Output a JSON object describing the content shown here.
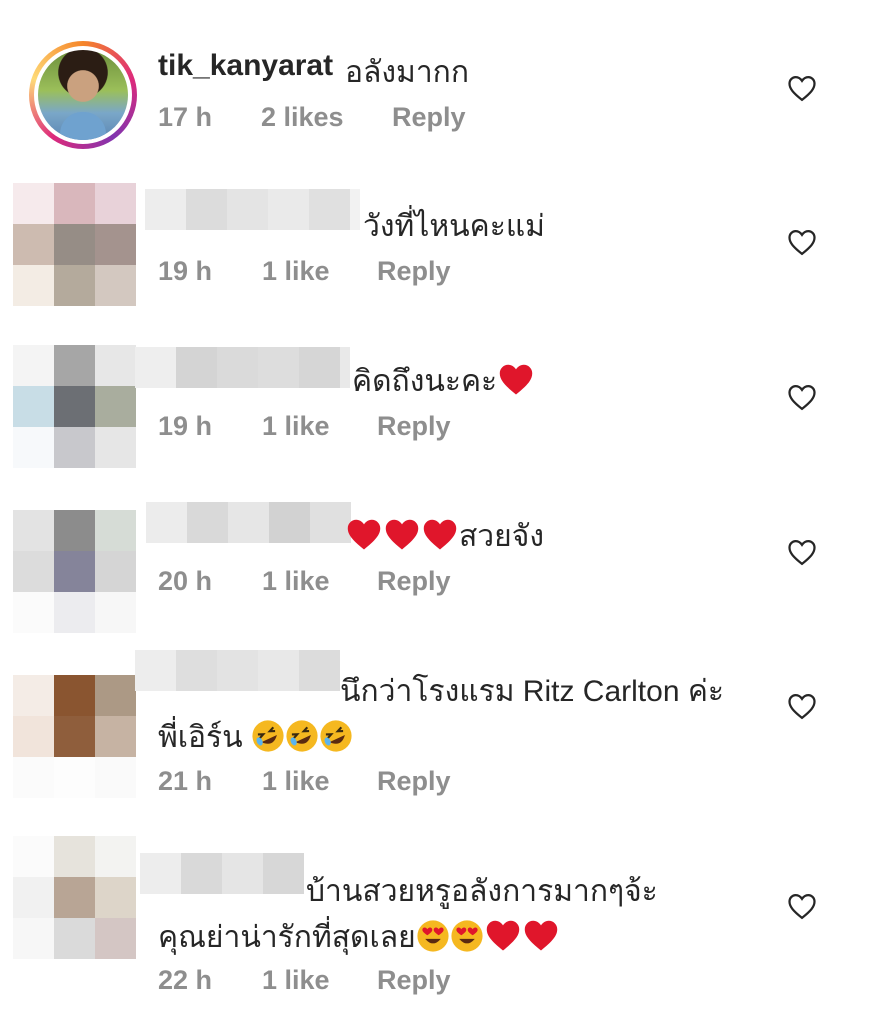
{
  "comments": [
    {
      "username": "tik_kanyarat",
      "text": "อลังมากก",
      "time": "17 h",
      "likes": "2 likes",
      "reply": "Reply"
    },
    {
      "text": "วังที่ไหนคะแม่",
      "time": "19 h",
      "likes": "1 like",
      "reply": "Reply"
    },
    {
      "text": "คิดถึงนะคะ",
      "time": "19 h",
      "likes": "1 like",
      "reply": "Reply"
    },
    {
      "text": "สวยจัง",
      "time": "20 h",
      "likes": "1 like",
      "reply": "Reply"
    },
    {
      "text_line1": "นึกว่าโรงแรม Ritz Carlton ค่ะ",
      "text_line2": "พี่เอิร์น",
      "time": "21 h",
      "likes": "1 like",
      "reply": "Reply"
    },
    {
      "text_line1": "บ้านสวยหรูอลังการมากๆจ้ะ",
      "text_line2": "คุณย่าน่ารักที่สุดเลย",
      "time": "22 h",
      "likes": "1 like",
      "reply": "Reply"
    }
  ],
  "icons": {
    "like": "heart-outline-icon",
    "red_heart": "red-heart-emoji",
    "laughing": "rolling-laughing-emoji",
    "heart_eyes": "heart-eyes-emoji"
  },
  "colors": {
    "text": "#262626",
    "meta": "#8e8e8e",
    "heart_red": "#e0162b",
    "emoji_yellow": "#f5b820"
  }
}
